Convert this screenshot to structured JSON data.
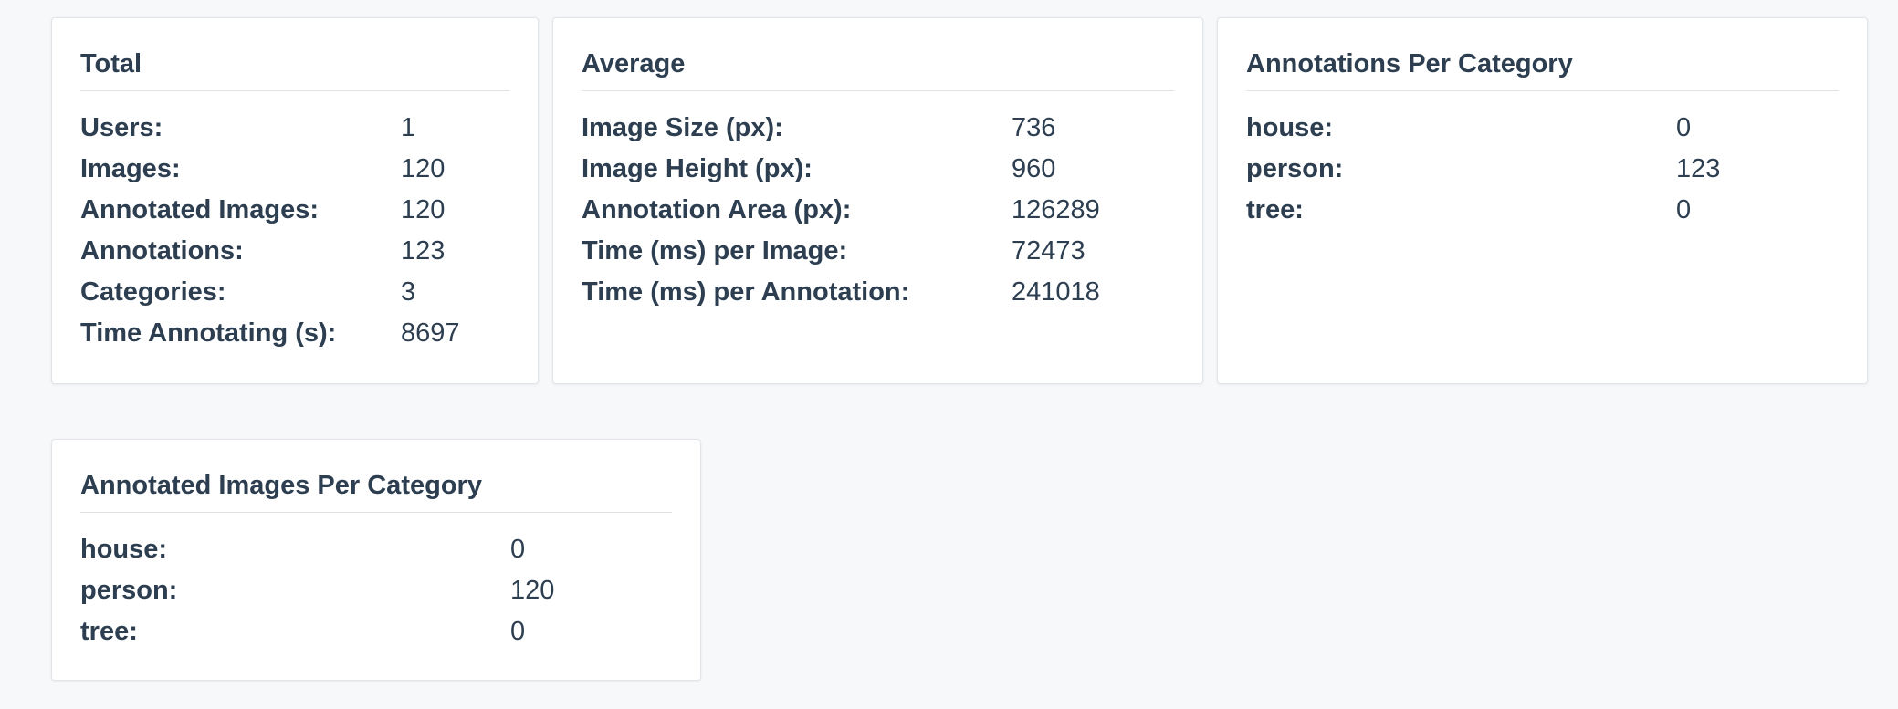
{
  "total": {
    "title": "Total",
    "rows": [
      {
        "label": "Users:",
        "value": "1"
      },
      {
        "label": "Images:",
        "value": "120"
      },
      {
        "label": "Annotated Images:",
        "value": "120"
      },
      {
        "label": "Annotations:",
        "value": "123"
      },
      {
        "label": "Categories:",
        "value": "3"
      },
      {
        "label": "Time Annotating (s):",
        "value": "8697"
      }
    ]
  },
  "average": {
    "title": "Average",
    "rows": [
      {
        "label": "Image Size (px):",
        "value": "736"
      },
      {
        "label": "Image Height (px):",
        "value": "960"
      },
      {
        "label": "Annotation Area (px):",
        "value": "126289"
      },
      {
        "label": "Time (ms) per Image:",
        "value": "72473"
      },
      {
        "label": "Time (ms) per Annotation:",
        "value": "241018"
      }
    ]
  },
  "annotations_per_category": {
    "title": "Annotations Per Category",
    "rows": [
      {
        "label": "house:",
        "value": "0"
      },
      {
        "label": "person:",
        "value": "123"
      },
      {
        "label": "tree:",
        "value": "0"
      }
    ]
  },
  "annotated_images_per_category": {
    "title": "Annotated Images Per Category",
    "rows": [
      {
        "label": "house:",
        "value": "0"
      },
      {
        "label": "person:",
        "value": "120"
      },
      {
        "label": "tree:",
        "value": "0"
      }
    ]
  }
}
